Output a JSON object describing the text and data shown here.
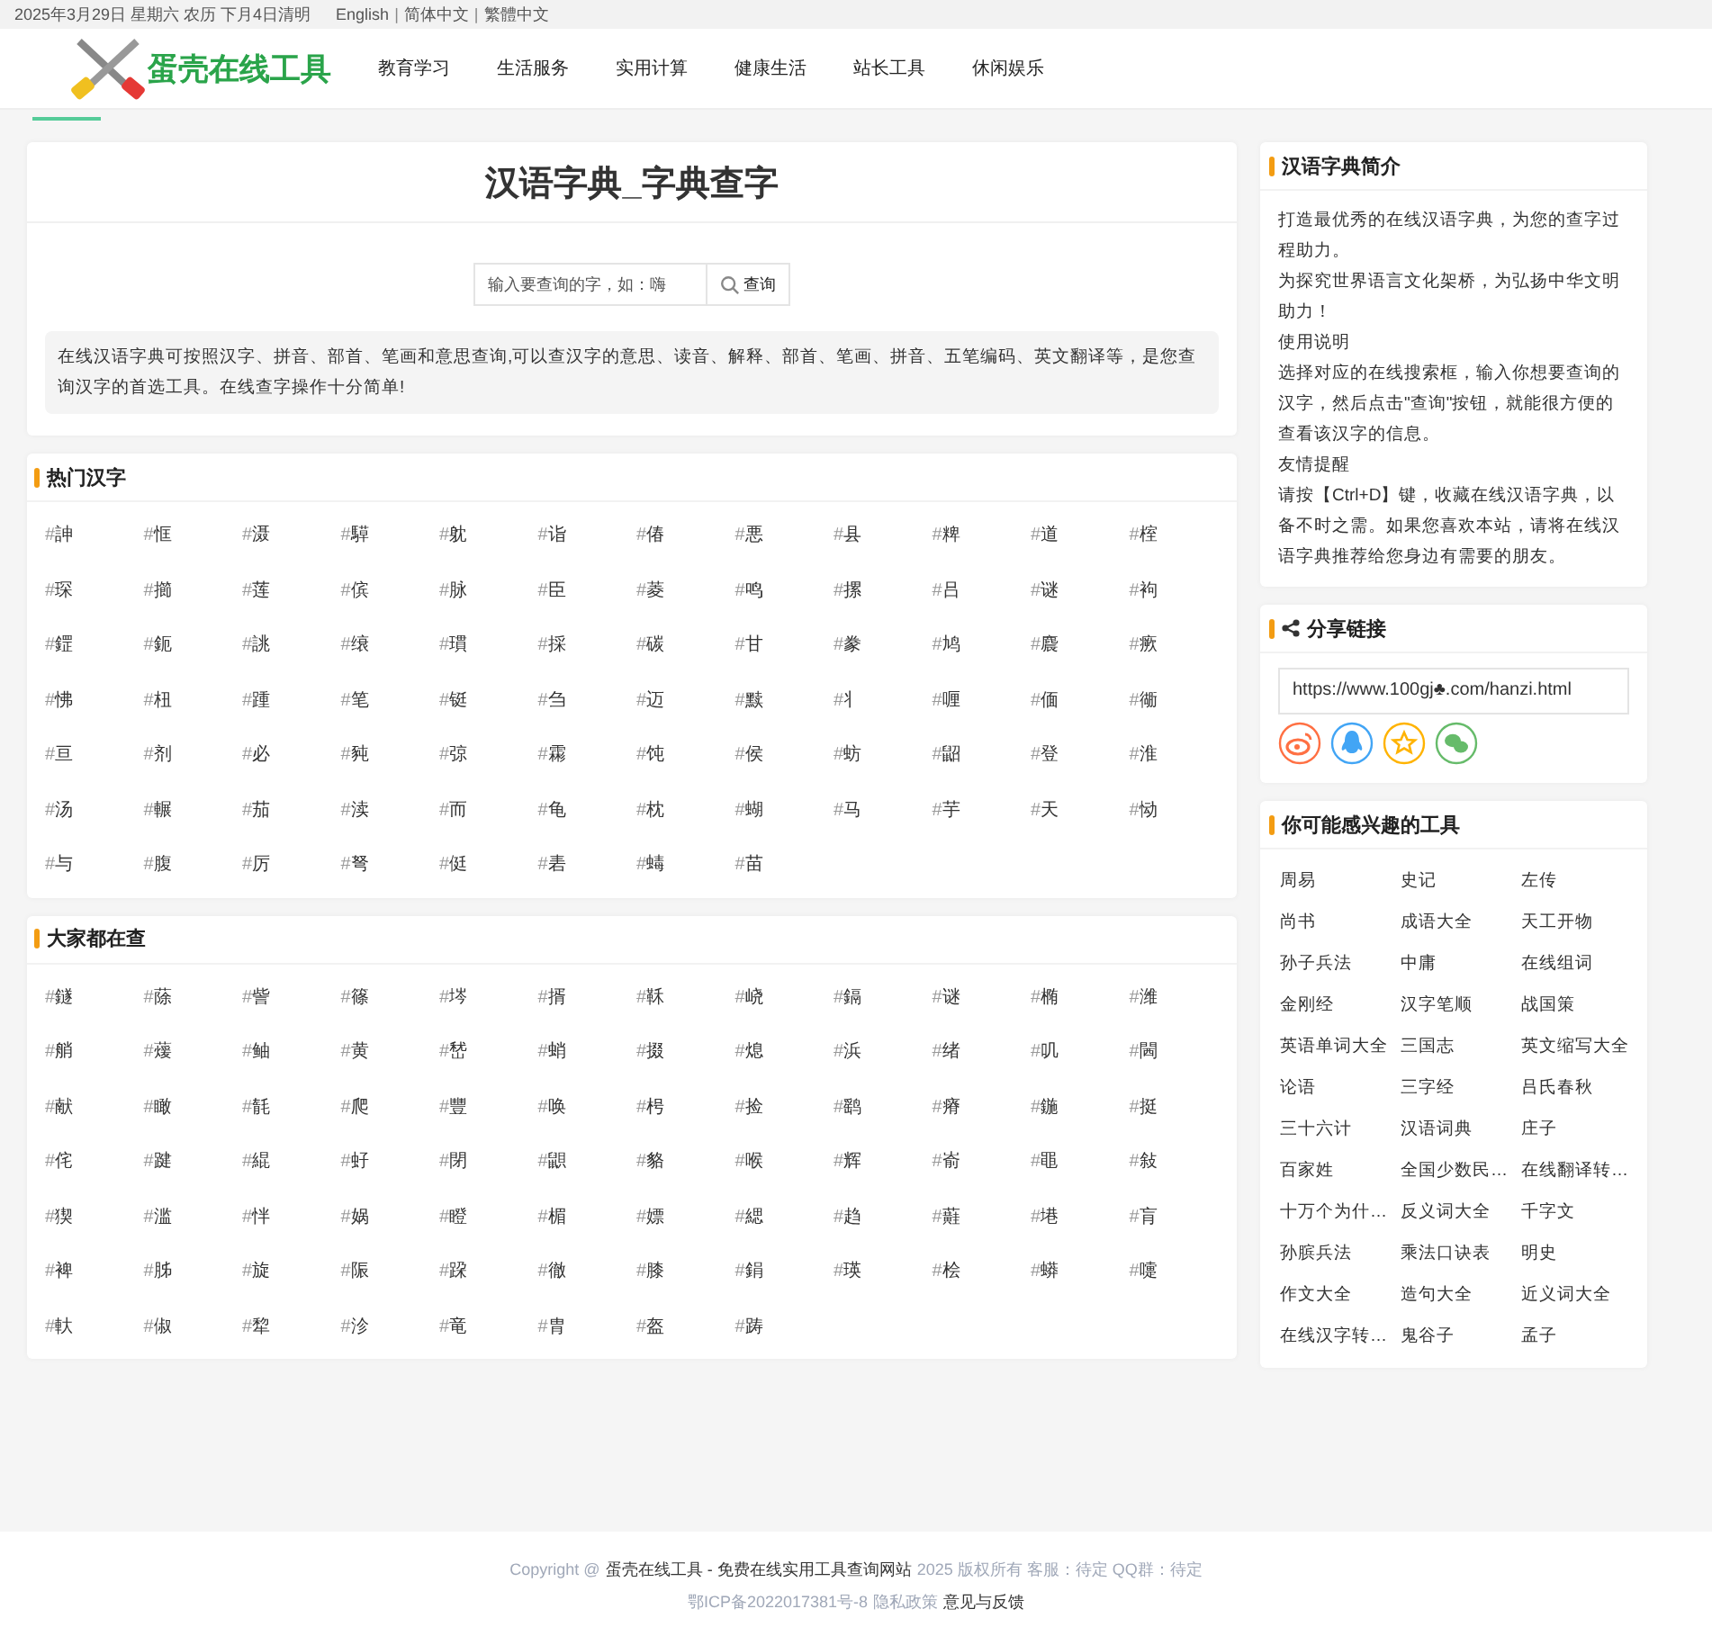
{
  "topbar": {
    "date": "2025年3月29日 星期六 农历 下月4日清明",
    "languages": [
      "English",
      "简体中文",
      "繁體中文"
    ],
    "separator": "|"
  },
  "header": {
    "logo": "蛋壳在线工具",
    "nav": [
      "教育学习",
      "生活服务",
      "实用计算",
      "健康生活",
      "站长工具",
      "休闲娱乐"
    ]
  },
  "main": {
    "title": "汉语字典_字典查字",
    "search": {
      "placeholder": "输入要查询的字，如：嗨",
      "button": "查询"
    },
    "intro": "在线汉语字典可按照汉字、拼音、部首、笔画和意思查询,可以查汉字的意思、读音、解释、部首、笔画、拼音、五笔编码、英文翻译等，是您查询汉字的首选工具。在线查字操作十分简单!"
  },
  "sections": [
    {
      "title": "热门汉字",
      "mark": "#",
      "chars": [
        "訷",
        "恇",
        "滠",
        "騲",
        "躭",
        "诣",
        "偆",
        "悪",
        "县",
        "粺",
        "道",
        "榁",
        "琛",
        "擳",
        "莲",
        "傧",
        "脉",
        "臣",
        "菱",
        "鸣",
        "摞",
        "吕",
        "谜",
        "袧",
        "鎠",
        "鈪",
        "誂",
        "缞",
        "瑻",
        "採",
        "碳",
        "甘",
        "豢",
        "鸠",
        "麎",
        "瘚",
        "怫",
        "杻",
        "踵",
        "笔",
        "铤",
        "刍",
        "迈",
        "黩",
        "丬",
        "喱",
        "偭",
        "衚",
        "亘",
        "剂",
        "必",
        "豘",
        "弶",
        "霦",
        "饨",
        "侯",
        "蚄",
        "鼦",
        "登",
        "淮",
        "汤",
        "輾",
        "茄",
        "渎",
        "而",
        "龟",
        "枕",
        "蝴",
        "马",
        "芋",
        "天",
        "恸",
        "与",
        "腹",
        "厉",
        "弩",
        "侹",
        "砉",
        "蝳",
        "苗"
      ]
    },
    {
      "title": "大家都在查",
      "mark": "#",
      "chars": [
        "鐩",
        "蒢",
        "訾",
        "篠",
        "埁",
        "揟",
        "鞂",
        "峣",
        "鎘",
        "谜",
        "椭",
        "潍",
        "艄",
        "蕿",
        "鲉",
        "黄",
        "嵆",
        "蛸",
        "掇",
        "熄",
        "浜",
        "绪",
        "叽",
        "閪",
        "献",
        "瞰",
        "毻",
        "爬",
        "豐",
        "唤",
        "枵",
        "捡",
        "鹞",
        "瘠",
        "鍦",
        "挺",
        "侘",
        "踺",
        "緄",
        "虸",
        "閉",
        "鼰",
        "貉",
        "喉",
        "辉",
        "嵛",
        "黽",
        "敍",
        "猰",
        "滥",
        "怑",
        "娲",
        "瞪",
        "楣",
        "嫖",
        "緦",
        "趋",
        "蘳",
        "塂",
        "肓",
        "裨",
        "胏",
        "旋",
        "陙",
        "跥",
        "徹",
        "膝",
        "鋗",
        "瑛",
        "桧",
        "蟒",
        "嚏",
        "軑",
        "俶",
        "犂",
        "沴",
        "竜",
        "胄",
        "盔",
        "踌"
      ]
    }
  ],
  "sidebar": {
    "about": {
      "title": "汉语字典简介",
      "lines": [
        "打造最优秀的在线汉语字典，为您的查字过程助力。",
        "为探究世界语言文化架桥，为弘扬中华文明助力！",
        "使用说明",
        "选择对应的在线搜索框，输入你想要查询的汉字，然后点击\"查询\"按钮，就能很方便的查看该汉字的信息。",
        "友情提醒",
        "请按【Ctrl+D】键，收藏在线汉语字典，以备不时之需。如果您喜欢本站，请将在线汉语字典推荐给您身边有需要的朋友。"
      ]
    },
    "share": {
      "title": "分享链接",
      "url": "https://www.100gj♣.com/hanzi.html",
      "buttons": [
        {
          "kind": "weibo",
          "color": "#ff7043"
        },
        {
          "kind": "qq",
          "color": "#42a5f5"
        },
        {
          "kind": "star",
          "color": "#ffb300"
        },
        {
          "kind": "wechat",
          "color": "#66bb6a"
        }
      ]
    },
    "tools": {
      "title": "你可能感兴趣的工具",
      "items": [
        "周易",
        "史记",
        "左传",
        "尚书",
        "成语大全",
        "天工开物",
        "孙子兵法",
        "中庸",
        "在线组词",
        "金刚经",
        "汉字笔顺",
        "战国策",
        "英语单词大全",
        "三国志",
        "英文缩写大全",
        "论语",
        "三字经",
        "吕氏春秋",
        "三十六计",
        "汉语词典",
        "庄子",
        "百家姓",
        "全国少数民…",
        "在线翻译转…",
        "十万个为什…",
        "反义词大全",
        "千字文",
        "孙膑兵法",
        "乘法口诀表",
        "明史",
        "作文大全",
        "造句大全",
        "近义词大全",
        "在线汉字转…",
        "鬼谷子",
        "孟子"
      ]
    }
  },
  "footer": {
    "line1": [
      "Copyright @",
      "蛋壳在线工具 - 免费在线实用工具查询网站",
      "2025 版权所有 客服：待定 QQ群：待定"
    ],
    "line2": [
      "鄂ICP备2022017381号-8",
      "隐私政策",
      "意见与反馈"
    ]
  }
}
